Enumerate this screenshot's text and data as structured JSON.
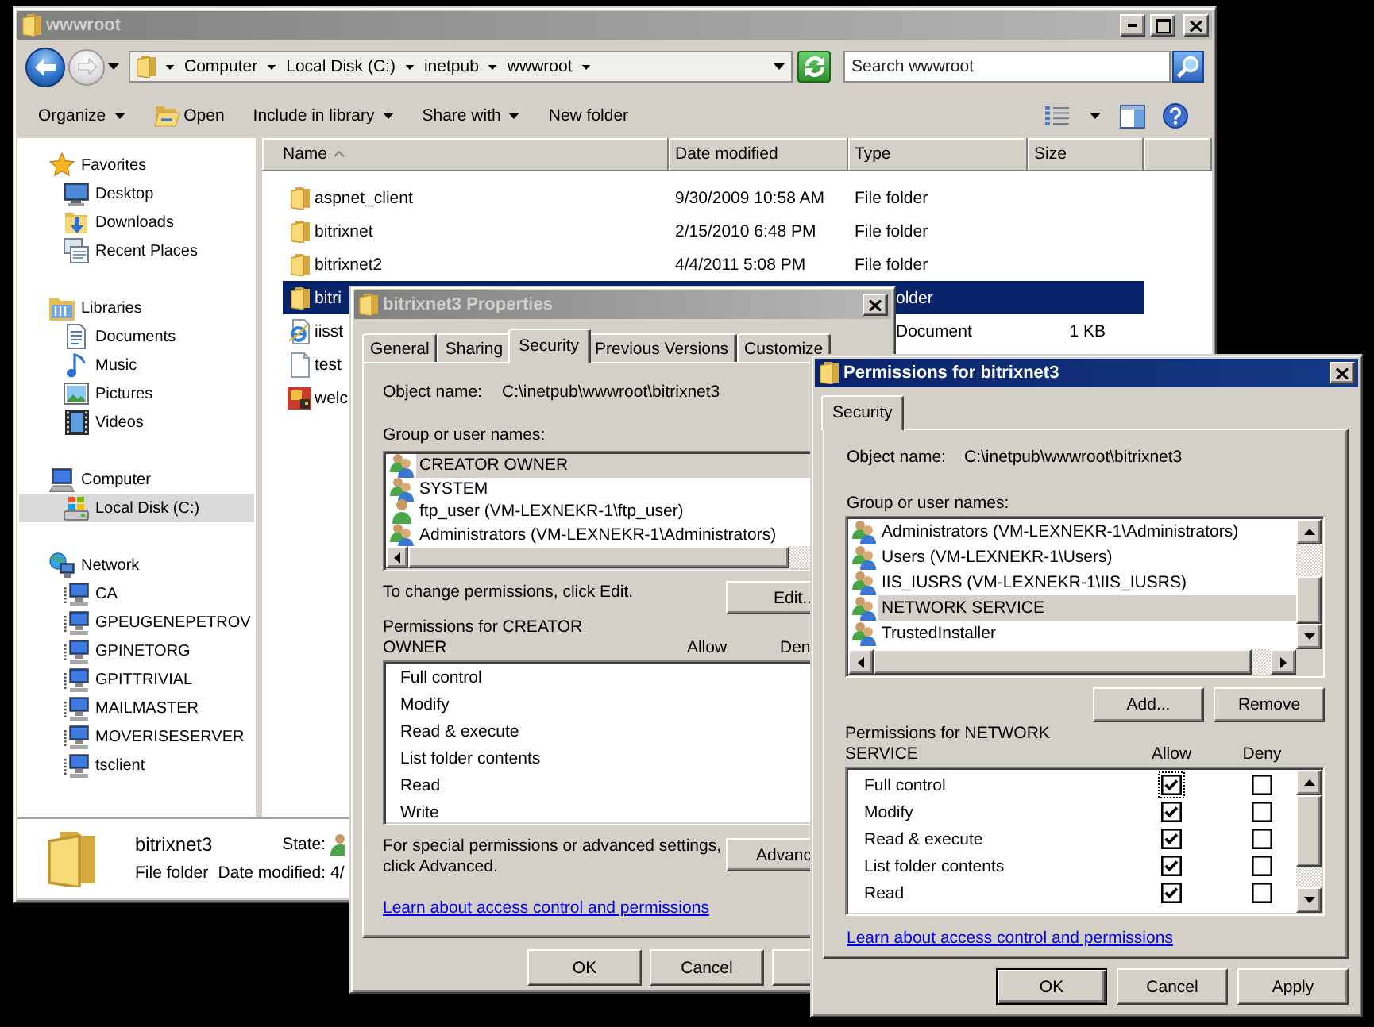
{
  "explorer": {
    "title": "wwwroot",
    "active": false,
    "address": {
      "crumbs": [
        "Computer",
        "Local Disk (C:)",
        "inetpub",
        "wwwroot"
      ]
    },
    "search": {
      "placeholder": "Search wwwroot"
    },
    "toolbar": [
      {
        "label": "Organize",
        "kind": "menu"
      },
      {
        "label": "Open",
        "kind": "icon"
      },
      {
        "label": "Include in library",
        "kind": "menu"
      },
      {
        "label": "Share with",
        "kind": "menu"
      },
      {
        "label": "New folder",
        "kind": "plain"
      }
    ],
    "sidebar": [
      {
        "label": "Favorites",
        "kind": "favorites",
        "selected": false,
        "children": [
          {
            "label": "Desktop",
            "kind": "desktop",
            "selected": false
          },
          {
            "label": "Downloads",
            "kind": "downloads",
            "selected": false
          },
          {
            "label": "Recent Places",
            "kind": "recent",
            "selected": false
          }
        ]
      },
      {
        "label": "Libraries",
        "kind": "libraries",
        "selected": false,
        "children": [
          {
            "label": "Documents",
            "kind": "documents",
            "selected": false
          },
          {
            "label": "Music",
            "kind": "music",
            "selected": false
          },
          {
            "label": "Pictures",
            "kind": "pictures",
            "selected": false
          },
          {
            "label": "Videos",
            "kind": "videos",
            "selected": false
          }
        ]
      },
      {
        "label": "Computer",
        "kind": "computer",
        "selected": false,
        "children": [
          {
            "label": "Local Disk (C:)",
            "kind": "disk",
            "selected": true
          }
        ]
      },
      {
        "label": "Network",
        "kind": "network",
        "selected": false,
        "children": [
          {
            "label": "CA",
            "kind": "pc",
            "selected": false
          },
          {
            "label": "GPEUGENEPETROV",
            "kind": "pc",
            "selected": false
          },
          {
            "label": "GPINETORG",
            "kind": "pc",
            "selected": false
          },
          {
            "label": "GPITTRIVIAL",
            "kind": "pc",
            "selected": false
          },
          {
            "label": "MAILMASTER",
            "kind": "pc",
            "selected": false
          },
          {
            "label": "MOVERISESERVER",
            "kind": "pc",
            "selected": false
          },
          {
            "label": "tsclient",
            "kind": "pc",
            "selected": false
          }
        ]
      }
    ],
    "columns": [
      {
        "label": "Name",
        "sorted": true
      },
      {
        "label": "Date modified",
        "sorted": false
      },
      {
        "label": "Type",
        "sorted": false
      },
      {
        "label": "Size",
        "sorted": false
      }
    ],
    "files": [
      {
        "name": "aspnet_client",
        "kind": "folder",
        "date": "9/30/2009 10:58 AM",
        "type": "File folder",
        "selected": false
      },
      {
        "name": "bitrixnet",
        "kind": "folder",
        "date": "2/15/2010 6:48 PM",
        "type": "File folder",
        "selected": false
      },
      {
        "name": "bitrixnet2",
        "kind": "folder",
        "date": "4/4/2011 5:08 PM",
        "type": "File folder",
        "selected": false
      },
      {
        "name": "bitri",
        "kind": "folder",
        "type": "older",
        "type_cut": true,
        "selected": true
      },
      {
        "name": "iisst",
        "kind": "web",
        "type": "Document",
        "type_cut": true,
        "size": "1 KB",
        "selected": false
      },
      {
        "name": "test",
        "kind": "text",
        "selected": false
      },
      {
        "name": "welc",
        "kind": "image",
        "selected": false
      }
    ],
    "details": {
      "name": "bitrixnet3",
      "type": "File folder",
      "fields": [
        {
          "label": "State:",
          "kind": "icon"
        },
        {
          "label": "Date modified:",
          "kind": "text",
          "value": "4/"
        }
      ]
    }
  },
  "properties": {
    "title": "bitrixnet3 Properties",
    "active": false,
    "tabs": [
      {
        "label": "General",
        "selected": false
      },
      {
        "label": "Sharing",
        "selected": false
      },
      {
        "label": "Security",
        "selected": true
      },
      {
        "label": "Previous Versions",
        "selected": false
      },
      {
        "label": "Customize",
        "selected": false
      }
    ],
    "object_label": "Object name:",
    "object_name": "C:\\inetpub\\wwwroot\\bitrixnet3",
    "groups_label": "Group or user names:",
    "users": [
      {
        "name": "CREATOR OWNER",
        "kind": "group",
        "selected": true
      },
      {
        "name": "SYSTEM",
        "kind": "group",
        "selected": false
      },
      {
        "name": "ftp_user (VM-LEXNEKR-1\\ftp_user)",
        "kind": "user",
        "selected": false
      },
      {
        "name": "Administrators (VM-LEXNEKR-1\\Administrators)",
        "kind": "group",
        "selected": false
      }
    ],
    "edit_hint": "To change permissions, click Edit.",
    "edit_button": "Edit..",
    "permissions_label": "Permissions for CREATOR OWNER",
    "allow_label": "Allow",
    "deny_label": "Den",
    "permissions": [
      "Full control",
      "Modify",
      "Read & execute",
      "List folder contents",
      "Read",
      "Write"
    ],
    "advanced_hint": "For special permissions or advanced settings, click Advanced.",
    "advanced_button": "Advanc",
    "link": "Learn about access control and permissions",
    "buttons": [
      {
        "label": "OK",
        "kind": "full"
      },
      {
        "label": "Cancel",
        "kind": "full"
      },
      {
        "kind": "cut"
      }
    ]
  },
  "permissions_dialog": {
    "title": "Permissions for bitrixnet3",
    "active": true,
    "tabs": [
      {
        "label": "Security",
        "selected": true
      }
    ],
    "object_label": "Object name:",
    "object_name": "C:\\inetpub\\wwwroot\\bitrixnet3",
    "groups_label": "Group or user names:",
    "users": [
      {
        "name": "Administrators (VM-LEXNEKR-1\\Administrators)",
        "kind": "group",
        "selected": false
      },
      {
        "name": "Users (VM-LEXNEKR-1\\Users)",
        "kind": "group",
        "selected": false
      },
      {
        "name": "IIS_IUSRS (VM-LEXNEKR-1\\IIS_IUSRS)",
        "kind": "group",
        "selected": false
      },
      {
        "name": "NETWORK SERVICE",
        "kind": "group",
        "selected": true
      },
      {
        "name": "TrustedInstaller",
        "kind": "group",
        "selected": false
      }
    ],
    "list_buttons": [
      "Add...",
      "Remove"
    ],
    "permissions_label": "Permissions for NETWORK SERVICE",
    "allow_label": "Allow",
    "deny_label": "Deny",
    "permissions": [
      {
        "name": "Full control",
        "allow": true,
        "deny": false,
        "focused": true
      },
      {
        "name": "Modify",
        "allow": true,
        "deny": false,
        "focused": false
      },
      {
        "name": "Read & execute",
        "allow": true,
        "deny": false,
        "focused": false
      },
      {
        "name": "List folder contents",
        "allow": true,
        "deny": false,
        "focused": false
      },
      {
        "name": "Read",
        "allow": true,
        "deny": false,
        "focused": false
      }
    ],
    "link": "Learn about access control and permissions",
    "buttons": [
      {
        "label": "OK",
        "default": true
      },
      {
        "label": "Cancel",
        "default": false
      },
      {
        "label": "Apply",
        "default": false
      }
    ]
  }
}
